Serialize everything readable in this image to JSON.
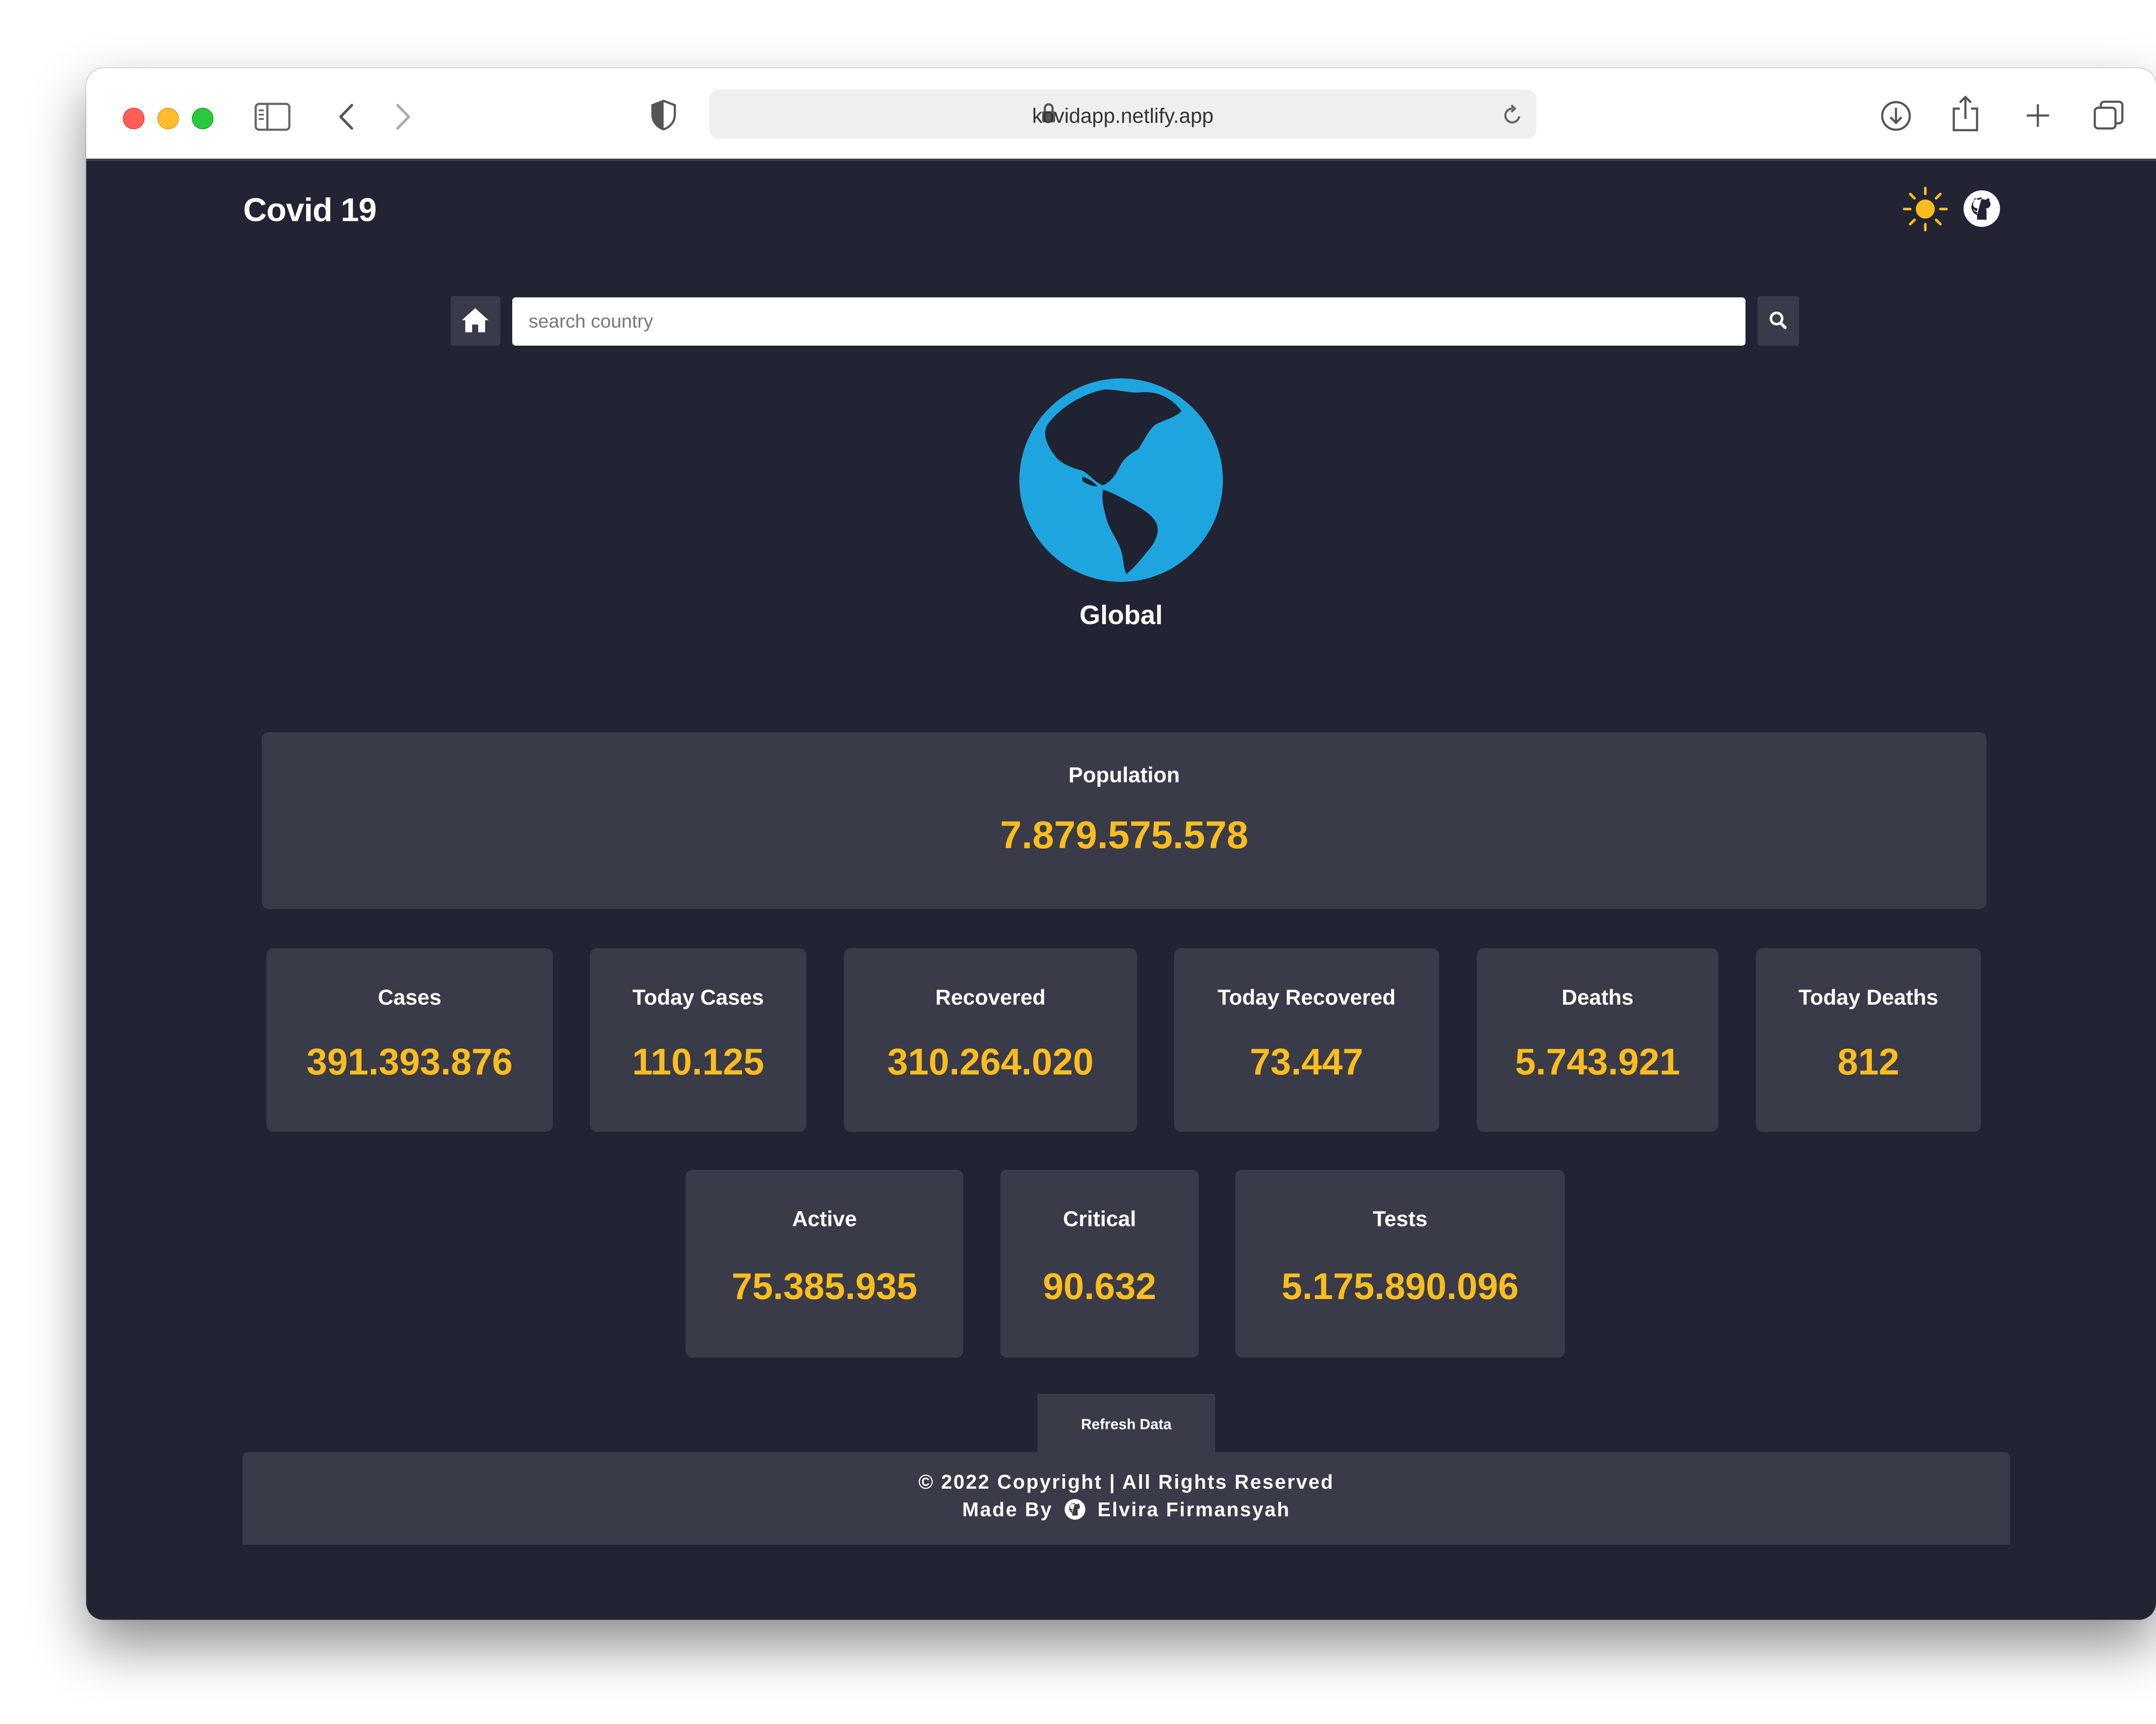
{
  "browser": {
    "url": "kovidapp.netlify.app"
  },
  "header": {
    "brand": "Covid 19"
  },
  "search": {
    "placeholder": "search country"
  },
  "scope": {
    "title": "Global"
  },
  "population": {
    "label": "Population",
    "value": "7.879.575.578"
  },
  "stats_row1": [
    {
      "label": "Cases",
      "value": "391.393.876"
    },
    {
      "label": "Today Cases",
      "value": "110.125"
    },
    {
      "label": "Recovered",
      "value": "310.264.020"
    },
    {
      "label": "Today Recovered",
      "value": "73.447"
    },
    {
      "label": "Deaths",
      "value": "5.743.921"
    },
    {
      "label": "Today Deaths",
      "value": "812"
    }
  ],
  "stats_row2": [
    {
      "label": "Active",
      "value": "75.385.935"
    },
    {
      "label": "Critical",
      "value": "90.632"
    },
    {
      "label": "Tests",
      "value": "5.175.890.096"
    }
  ],
  "actions": {
    "refresh_label": "Refresh Data"
  },
  "footer": {
    "line1": "© 2022 Copyright | All Rights Reserved",
    "made_by": "Made By",
    "author": "Elvira Firmansyah"
  },
  "colors": {
    "page_bg": "#222434",
    "card_bg": "#3a3b49",
    "accent_value": "#fbbd1e",
    "globe": "#1ea5e0"
  }
}
